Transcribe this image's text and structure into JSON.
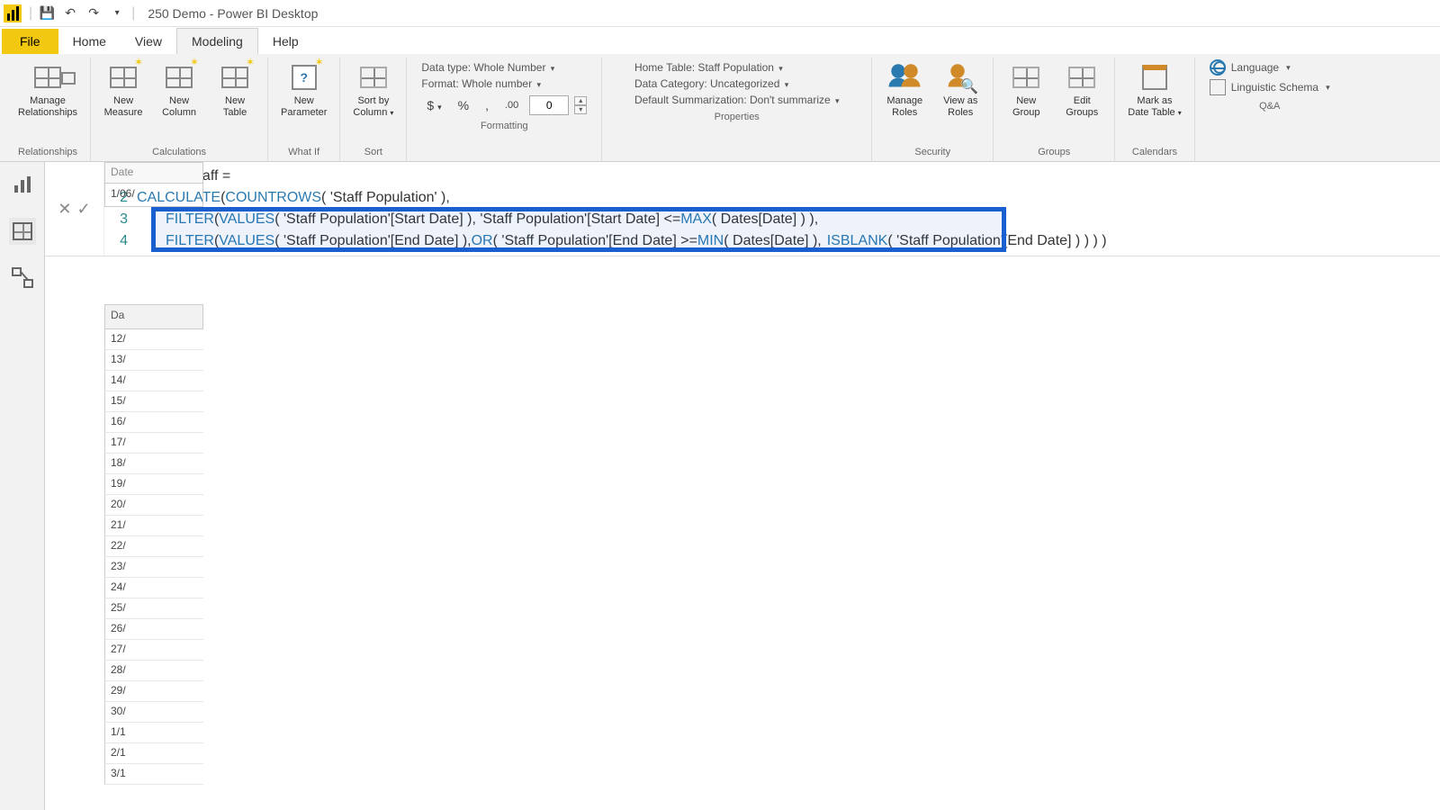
{
  "title": "250 Demo - Power BI Desktop",
  "tabs": {
    "file": "File",
    "home": "Home",
    "view": "View",
    "modeling": "Modeling",
    "help": "Help"
  },
  "ribbon": {
    "relationships": {
      "manage": "Manage\nRelationships",
      "group": "Relationships"
    },
    "calculations": {
      "measure": "New\nMeasure",
      "column": "New\nColumn",
      "table": "New\nTable",
      "group": "Calculations"
    },
    "whatif": {
      "param": "New\nParameter",
      "group": "What If"
    },
    "sort": {
      "sortby": "Sort by\nColumn",
      "group": "Sort"
    },
    "formatting": {
      "datatype": "Data type: Whole Number",
      "format": "Format: Whole number",
      "decimals": "0",
      "group": "Formatting"
    },
    "properties": {
      "hometable": "Home Table: Staff Population",
      "datacat": "Data Category: Uncategorized",
      "defsum": "Default Summarization: Don't summarize",
      "group": "Properties"
    },
    "security": {
      "manage": "Manage\nRoles",
      "viewas": "View as\nRoles",
      "group": "Security"
    },
    "groups": {
      "new": "New\nGroup",
      "edit": "Edit\nGroups",
      "group": "Groups"
    },
    "calendars": {
      "mark": "Mark as\nDate Table",
      "group": "Calendars"
    },
    "qa": {
      "lang": "Language",
      "schema": "Linguistic Schema",
      "group": "Q&A"
    }
  },
  "formula": {
    "line1_a": "Current Staff =",
    "line2_a": "CALCULATE",
    "line2_b": "( ",
    "line2_c": "COUNTROWS",
    "line2_d": "( 'Staff Population' ),",
    "line3_a": "FILTER",
    "line3_b": "( ",
    "line3_c": "VALUES",
    "line3_d": "( 'Staff Population'[Start Date] ), 'Staff Population'[Start Date] <= ",
    "line3_e": "MAX",
    "line3_f": "( Dates[Date] ) ),",
    "line4_a": "FILTER",
    "line4_b": "( ",
    "line4_c": "VALUES",
    "line4_d": "( 'Staff Population'[End Date] ), ",
    "line4_e": "OR",
    "line4_f": "( 'Staff Population'[End Date] >= ",
    "line4_g": "MIN",
    "line4_h": "( Dates[Date] ),",
    "line4_i": "ISBLANK",
    "line4_j": "( 'Staff Population'[End Date] ) ) ) )"
  },
  "grid": {
    "top_header": "Date",
    "top_value": "1/06/",
    "col_header": "Da",
    "rows": [
      "12/",
      "13/",
      "14/",
      "15/",
      "16/",
      "17/",
      "18/",
      "19/",
      "20/",
      "21/",
      "22/",
      "23/",
      "24/",
      "25/",
      "26/",
      "27/",
      "28/",
      "29/",
      "30/",
      "1/1",
      "2/1",
      "3/1"
    ]
  }
}
